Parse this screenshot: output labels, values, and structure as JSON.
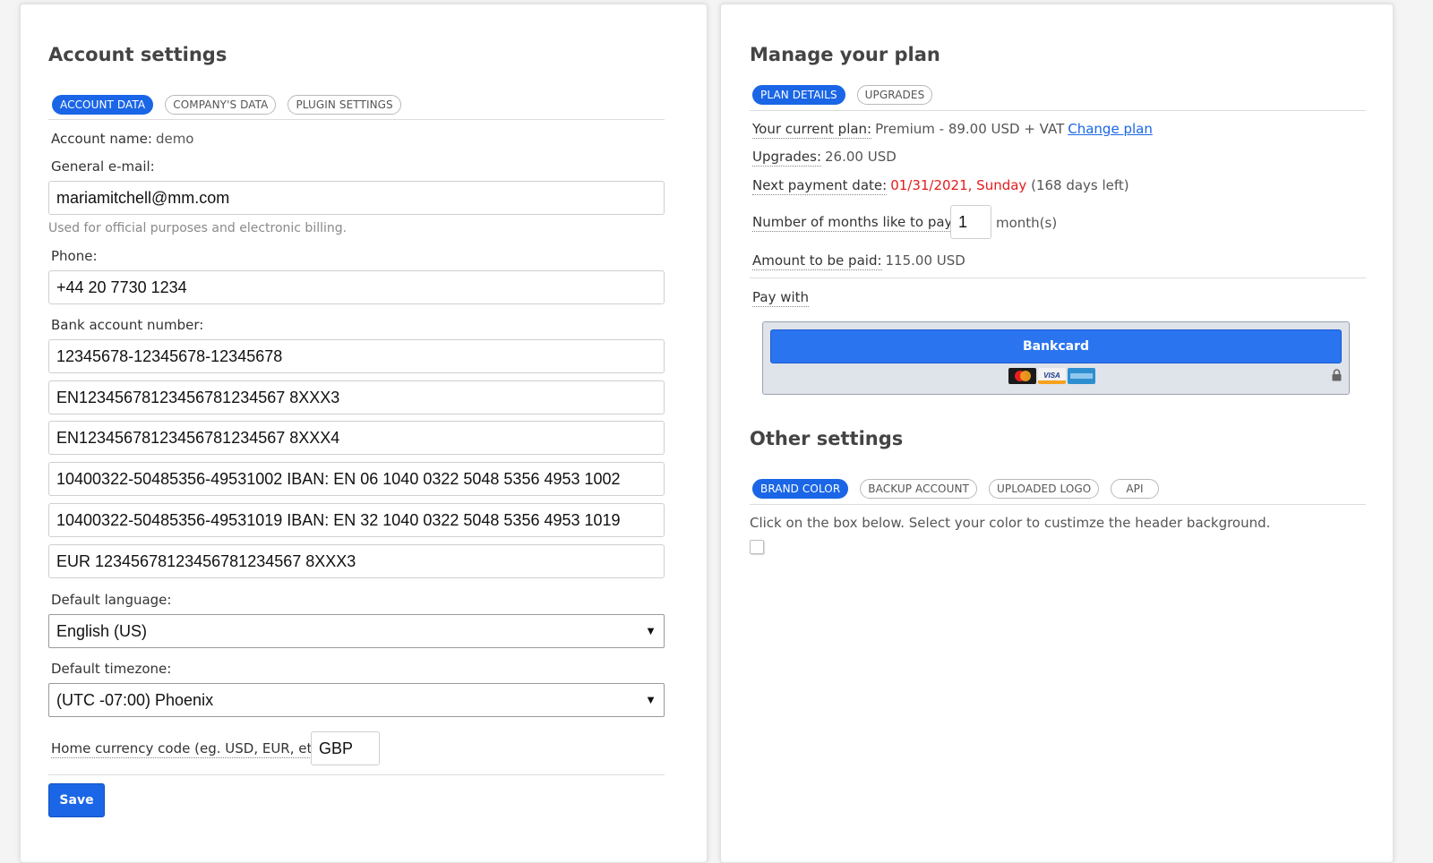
{
  "account": {
    "title": "Account settings",
    "tabs": [
      {
        "label": "ACCOUNT DATA",
        "active": true
      },
      {
        "label": "COMPANY'S DATA",
        "active": false
      },
      {
        "label": "PLUGIN SETTINGS",
        "active": false
      }
    ],
    "account_name_label": "Account name:",
    "account_name_value": "demo",
    "email_label": "General e-mail:",
    "email_value": "mariamitchell@mm.com",
    "email_help": "Used for official purposes and electronic billing.",
    "phone_label": "Phone:",
    "phone_value": "+44 20 7730 1234",
    "bank_label": "Bank account number:",
    "bank_accounts": [
      "12345678-12345678-12345678",
      "EN12345678123456781234567 8XXX3",
      "EN12345678123456781234567 8XXX4",
      "10400322-50485356-49531002 IBAN: EN 06 1040 0322 5048 5356 4953 1002",
      "10400322-50485356-49531019 IBAN: EN 32 1040 0322 5048 5356 4953 1019",
      "EUR 12345678123456781234567 8XXX3"
    ],
    "language_label": "Default language:",
    "language_value": "English (US)",
    "timezone_label": "Default timezone:",
    "timezone_value": "(UTC -07:00) Phoenix",
    "currency_label": "Home currency code (eg. USD, EUR, etc.):",
    "currency_value": "GBP",
    "save_label": "Save"
  },
  "plan": {
    "title": "Manage your plan",
    "tabs": [
      {
        "label": "PLAN DETAILS",
        "active": true
      },
      {
        "label": "UPGRADES",
        "active": false
      }
    ],
    "current_plan_label": "Your current plan:",
    "current_plan_value": "Premium - 89.00 USD + VAT",
    "change_plan_link": "Change plan",
    "upgrades_label": "Upgrades:",
    "upgrades_value": "26.00 USD",
    "next_payment_label": "Next payment date:",
    "next_payment_value": "01/31/2021, Sunday",
    "days_left": "(168 days left)",
    "months_label": "Number of months like to pay:",
    "months_value": "1",
    "months_unit": "month(s)",
    "amount_label": "Amount to be paid:",
    "amount_value": "115.00 USD",
    "pay_with_label": "Pay with",
    "bankcard_label": "Bankcard"
  },
  "other": {
    "title": "Other settings",
    "tabs": [
      {
        "label": "BRAND COLOR",
        "active": true
      },
      {
        "label": "BACKUP ACCOUNT",
        "active": false
      },
      {
        "label": "UPLOADED LOGO",
        "active": false
      },
      {
        "label": "API",
        "active": false
      }
    ],
    "instruction": "Click on the box below. Select your color to custimze the header background."
  },
  "colors": {
    "accent": "#1a66e6",
    "danger": "#e31c1c"
  }
}
